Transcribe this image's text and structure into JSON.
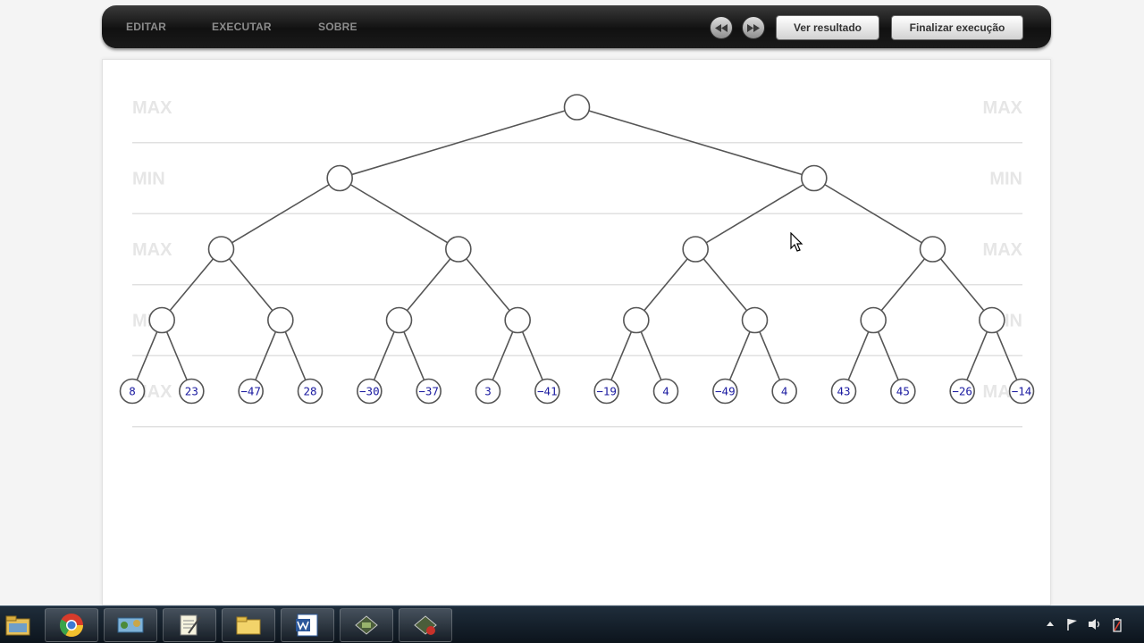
{
  "toolbar": {
    "menu": [
      {
        "id": "editar",
        "label": "EDITAR"
      },
      {
        "id": "executar",
        "label": "EXECUTAR"
      },
      {
        "id": "sobre",
        "label": "SOBRE"
      }
    ],
    "rewind_icon": "rewind-icon",
    "forward_icon": "fast-forward-icon",
    "view_result_label": "Ver resultado",
    "finish_label": "Finalizar execução"
  },
  "tree": {
    "levels": [
      {
        "label": "MAX"
      },
      {
        "label": "MIN"
      },
      {
        "label": "MAX"
      },
      {
        "label": "MIN"
      },
      {
        "label": "MAX"
      }
    ],
    "leaf_values": [
      8,
      23,
      -47,
      28,
      -30,
      -37,
      3,
      -41,
      -19,
      4,
      -49,
      4,
      43,
      45,
      -26,
      -14
    ],
    "colors": {
      "edge": "#555555",
      "node_border": "#555555",
      "leaf_text": "#1a1aa0",
      "level_label": "#e6e6e6",
      "level_line": "#e0e0e0"
    }
  },
  "taskbar": {
    "apps": [
      {
        "name": "file-explorer-icon"
      },
      {
        "name": "chrome-icon"
      },
      {
        "name": "network-app-icon"
      },
      {
        "name": "notepad-icon"
      },
      {
        "name": "folder-icon"
      },
      {
        "name": "word-icon"
      },
      {
        "name": "app-window-icon"
      },
      {
        "name": "app-window-icon-2"
      }
    ],
    "tray_icons": [
      "show-hidden-icons-icon",
      "flag-icon",
      "volume-icon",
      "power-icon"
    ]
  }
}
